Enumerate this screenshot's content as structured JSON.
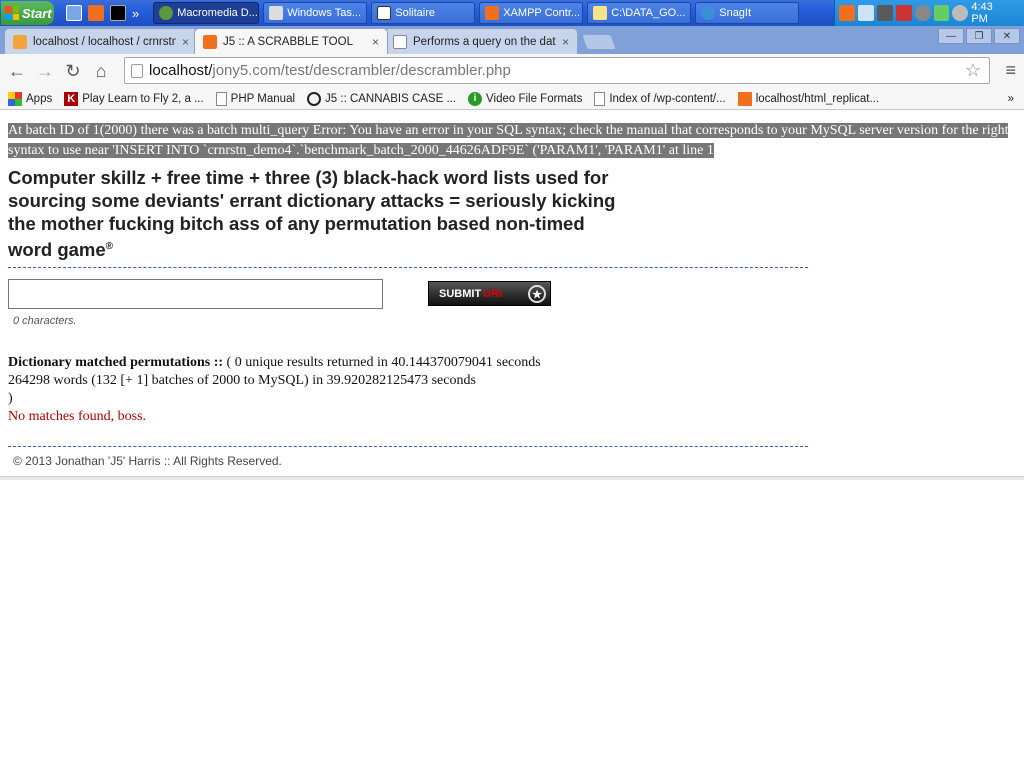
{
  "taskbar": {
    "start_label": "Start",
    "quicklaunch_more": "»",
    "buttons": [
      {
        "label": "Macromedia D...",
        "active": true
      },
      {
        "label": "Windows Tas..."
      },
      {
        "label": "Solitaire"
      },
      {
        "label": "XAMPP Contr..."
      },
      {
        "label": "C:\\DATA_GO..."
      },
      {
        "label": "SnagIt"
      }
    ],
    "clock": "4:43 PM"
  },
  "tabs": [
    {
      "label": "localhost / localhost / crnrstn",
      "close": "×",
      "icon": "pma-icon"
    },
    {
      "label": "J5 :: A SCRABBLE TOOL",
      "close": "×",
      "icon": "xampp-icon",
      "active": true
    },
    {
      "label": "Performs a query on the dat",
      "close": "×",
      "icon": "page-icon"
    }
  ],
  "window_controls": {
    "minimize": "—",
    "restore": "❐",
    "close": "✕"
  },
  "nav": {
    "back": "←",
    "forward": "→",
    "reload": "↻",
    "home": "⌂"
  },
  "address": {
    "host": "localhost/",
    "path": "jony5.com/test/descrambler/descrambler.php",
    "star": "☆"
  },
  "menu_icon": "≡",
  "bookmarks": [
    {
      "label": "Apps",
      "icon": "apps-icon"
    },
    {
      "label": "Play Learn to Fly 2, a ...",
      "icon": "k-icon"
    },
    {
      "label": "PHP Manual",
      "icon": "page-icon"
    },
    {
      "label": "J5 :: CANNABIS CASE ...",
      "icon": "j5-icon"
    },
    {
      "label": "Video File Formats",
      "icon": "info-icon"
    },
    {
      "label": "Index of /wp-content/...",
      "icon": "page-icon"
    },
    {
      "label": "localhost/html_replicat...",
      "icon": "xampp-icon"
    }
  ],
  "bookmarks_more": "»",
  "page": {
    "error": "At batch ID of 1(2000) there was a batch multi_query Error: You have an error in your SQL syntax; check the manual that corresponds to your MySQL server version for the right syntax to use near 'INSERT INTO `crnrstn_demo4`.`benchmark_batch_2000_44626ADF9E` ('PARAM1', 'PARAM1' at line 1",
    "headline": "Computer skillz + free time + three (3) black-hack word lists used for sourcing some deviants' errant dictionary attacks = seriously kicking the mother fucking bitch ass of any permutation based non-timed word game",
    "headline_mark": "®",
    "input_value": "",
    "submit_label": "SUBMIT",
    "submit_suffix": "URI",
    "char_count": "0 characters.",
    "results_heading": "Dictionary matched permutations ::",
    "results_line1": "( 0 unique results returned in 40.144370079041 seconds",
    "results_line2": "264298 words (132 [+ 1] batches of 2000 to MySQL) in 39.920282125473 seconds",
    "results_line3": ")",
    "no_matches": "No matches found, boss.",
    "copyright": "© 2013 Jonathan 'J5' Harris :: All Rights Reserved."
  }
}
